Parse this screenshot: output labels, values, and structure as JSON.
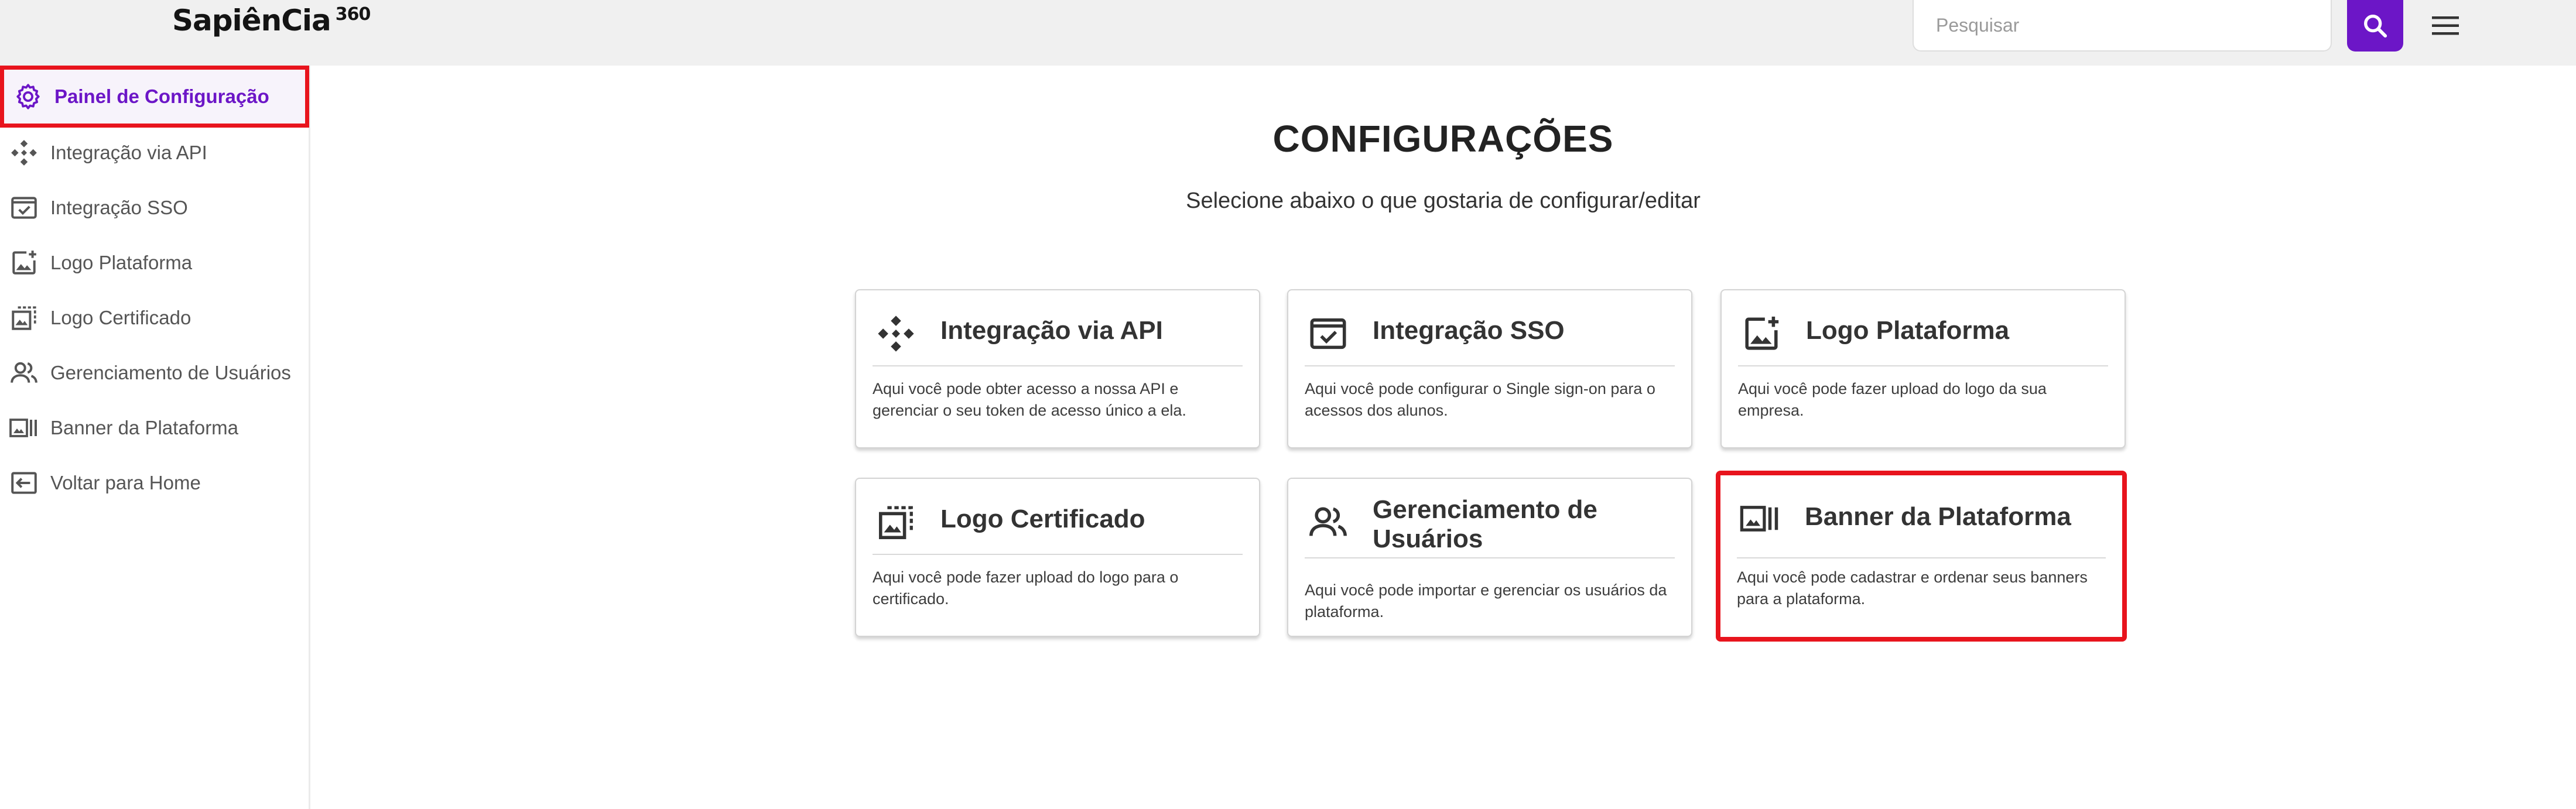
{
  "header": {
    "logo_text": "SapiênCia",
    "logo_suffix": "360",
    "search_placeholder": "Pesquisar",
    "colors": {
      "accent": "#6c16c7",
      "header_bg": "#f0f0f0"
    }
  },
  "sidebar": {
    "items": [
      {
        "label": "Painel de Configuração",
        "icon": "gear-icon",
        "active": true
      },
      {
        "label": "Integração via API",
        "icon": "api-icon"
      },
      {
        "label": "Integração SSO",
        "icon": "sso-check-icon"
      },
      {
        "label": "Logo Plataforma",
        "icon": "image-add-icon"
      },
      {
        "label": "Logo Certificado",
        "icon": "certificate-image-icon"
      },
      {
        "label": "Gerenciamento de Usuários",
        "icon": "users-icon"
      },
      {
        "label": "Banner da Plataforma",
        "icon": "banner-icon"
      },
      {
        "label": "Voltar para Home",
        "icon": "back-home-icon"
      }
    ]
  },
  "main": {
    "title": "CONFIGURAÇÕES",
    "subtitle": "Selecione abaixo o que gostaria de configurar/editar",
    "cards": [
      {
        "title": "Integração via API",
        "icon": "api-icon",
        "description": "Aqui você pode obter acesso a nossa API e gerenciar o seu token de acesso único a ela."
      },
      {
        "title": "Integração SSO",
        "icon": "sso-check-icon",
        "description": "Aqui você pode configurar o Single sign-on para o acessos dos alunos."
      },
      {
        "title": "Logo Plataforma",
        "icon": "image-add-icon",
        "description": "Aqui você pode fazer upload do logo da sua empresa."
      },
      {
        "title": "Logo Certificado",
        "icon": "certificate-image-icon",
        "description": "Aqui você pode fazer upload do logo para o certificado."
      },
      {
        "title": "Gerenciamento de Usuários",
        "icon": "users-icon",
        "description": "Aqui você pode importar e gerenciar os usuários da plataforma."
      },
      {
        "title": "Banner da Plataforma",
        "icon": "banner-icon",
        "description": "Aqui você pode cadastrar e ordenar seus banners para a plataforma."
      }
    ],
    "highlight_color": "#e8141d"
  }
}
